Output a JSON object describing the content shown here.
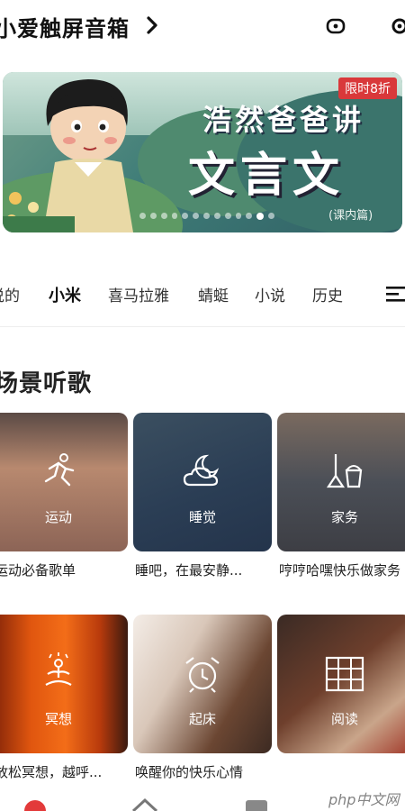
{
  "header": {
    "title": "小爱触屏音箱",
    "icons": [
      "chevron-right-icon",
      "speaker-icon",
      "settings-icon"
    ]
  },
  "banner": {
    "tag": "限时8折",
    "line1": "浩然爸爸讲",
    "line2": "文言文",
    "subtitle": "(课内篇)",
    "dots": 13,
    "active_dot": 11
  },
  "tabs": [
    {
      "label": "说的",
      "active": false
    },
    {
      "label": "小米",
      "active": true
    },
    {
      "label": "喜马拉雅",
      "active": false
    },
    {
      "label": "蜻蜓",
      "active": false
    },
    {
      "label": "小说",
      "active": false
    },
    {
      "label": "历史",
      "active": false
    }
  ],
  "section": {
    "title": "场景听歌"
  },
  "cards": [
    {
      "label": "运动",
      "caption": "运动必备歌单",
      "icon": "running-icon"
    },
    {
      "label": "睡觉",
      "caption": "睡吧，在最安静...",
      "icon": "moon-cloud-icon"
    },
    {
      "label": "家务",
      "caption": "哼哼哈嘿快乐做家务",
      "icon": "broom-bucket-icon"
    },
    {
      "label": "冥想",
      "caption": "放松冥想，越呼...",
      "icon": "meditation-icon"
    },
    {
      "label": "起床",
      "caption": "唤醒你的快乐心情",
      "icon": "alarm-clock-icon"
    },
    {
      "label": "阅读",
      "caption": "",
      "icon": "bookshelf-icon"
    }
  ],
  "watermark": "php中文网"
}
